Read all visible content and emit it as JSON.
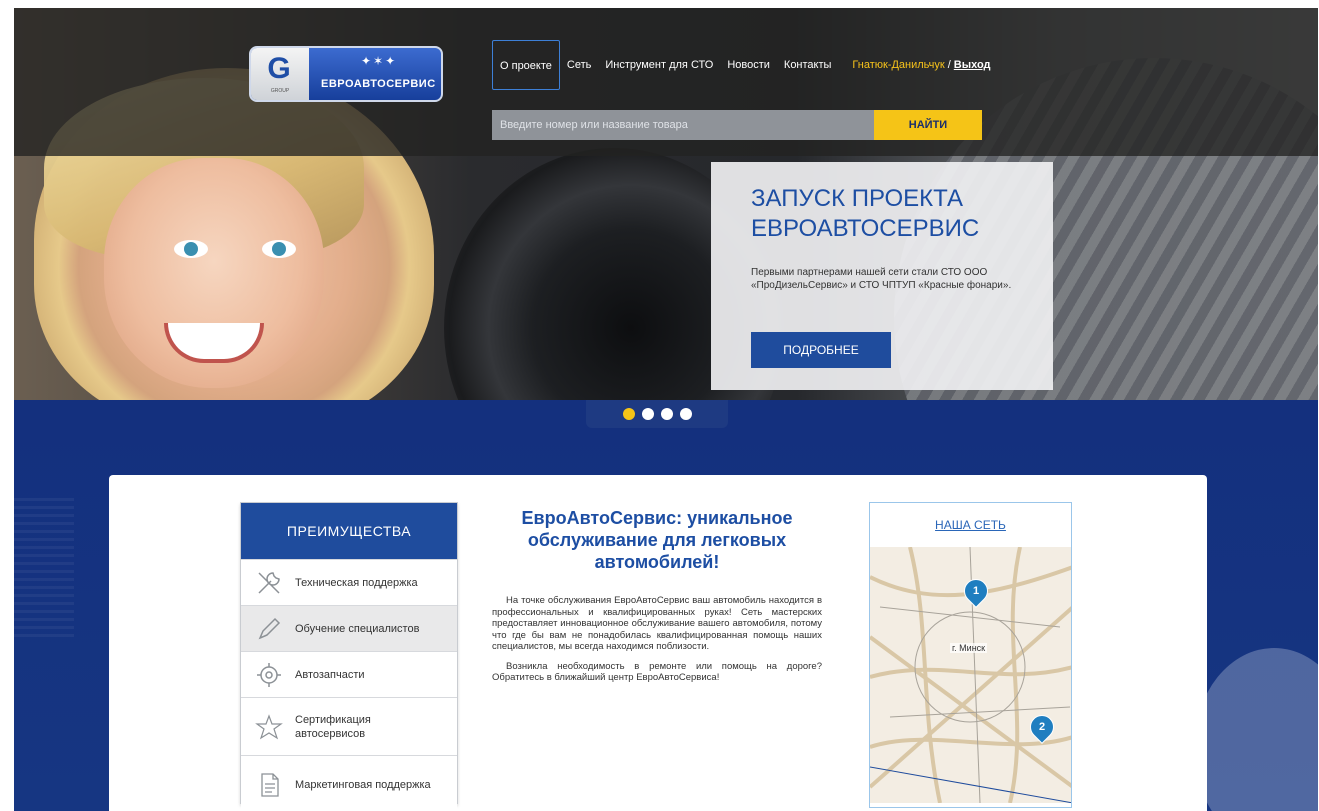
{
  "brand": {
    "logo_letter": "G",
    "logo_caption": "GROUP",
    "name": "ЕВРОАВТОСЕРВИС"
  },
  "nav": {
    "items": [
      "О проекте",
      "Сеть",
      "Инструмент для СТО",
      "Новости",
      "Контакты"
    ],
    "user": "Гнатюк-Данильчук",
    "separator": "/",
    "logout": "Выход"
  },
  "search": {
    "placeholder": "Введите номер или название товара",
    "button": "НАЙТИ"
  },
  "promo": {
    "title": "ЗАПУСК ПРОЕКТА ЕВРОАВТОСЕРВИС",
    "text": "Первыми партнерами нашей сети стали СТО ООО «ПроДизельСервис» и СТО ЧПТУП «Красные фонари».",
    "button": "ПОДРОБНЕЕ"
  },
  "slider": {
    "count": 4,
    "active": 1
  },
  "advantages": {
    "title": "ПРЕИМУЩЕСТВА",
    "items": [
      {
        "label": "Техническая поддержка",
        "icon": "wrench-icon"
      },
      {
        "label": "Обучение специалистов",
        "icon": "pencil-icon"
      },
      {
        "label": "Автозапчасти",
        "icon": "gear-icon"
      },
      {
        "label": "Сертификация автосервисов",
        "icon": "star-icon"
      },
      {
        "label": "Маркетинговая поддержка",
        "icon": "document-icon"
      }
    ]
  },
  "about": {
    "title": "ЕвроАвтоСервис: уникальное обслуживание для легковых автомобилей!",
    "p1": "На точке обслуживания ЕвроАвтоСервис ваш автомобиль находится в профессиональных и квалифицированных руках! Сеть мастерских предоставляет инновационное обслуживание вашего автомобиля, потому что где бы вам не понадобилась квалифицированная помощь наших специалистов, мы всегда находимся поблизости.",
    "p2": "Возникла необходимость в ремонте или помощь на дороге? Обратитесь в ближайший центр ЕвроАвтоСервиса!"
  },
  "network": {
    "title": "НАША СЕТЬ",
    "city": "г. Минск",
    "pins": [
      "1",
      "2"
    ]
  },
  "colors": {
    "brand_blue": "#1f4c9d",
    "accent_yellow": "#f5c417",
    "user_yellow": "#f7c31b"
  }
}
